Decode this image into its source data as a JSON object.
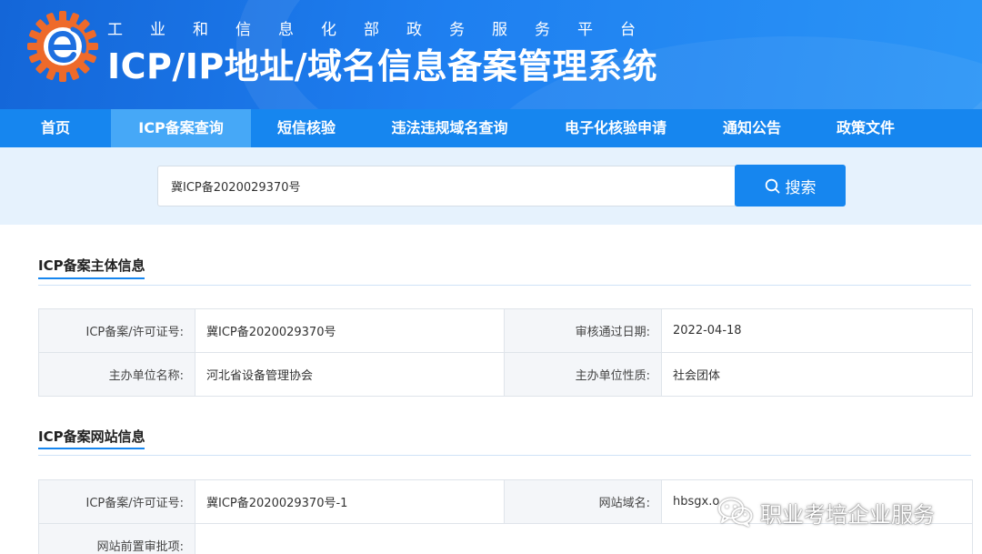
{
  "header": {
    "subtitle": "工业和信息化部政务服务平台",
    "title": "ICP/IP地址/域名信息备案管理系统"
  },
  "nav": {
    "items": [
      {
        "label": "首页",
        "active": false
      },
      {
        "label": "ICP备案查询",
        "active": true
      },
      {
        "label": "短信核验",
        "active": false
      },
      {
        "label": "违法违规域名查询",
        "active": false
      },
      {
        "label": "电子化核验申请",
        "active": false
      },
      {
        "label": "通知公告",
        "active": false
      },
      {
        "label": "政策文件",
        "active": false
      }
    ]
  },
  "search": {
    "value": "冀ICP备2020029370号",
    "button_label": "搜索",
    "button_icon": "search-icon"
  },
  "subject_info": {
    "title": "ICP备案主体信息",
    "rows": [
      {
        "label1": "ICP备案/许可证号:",
        "value1": "冀ICP备2020029370号",
        "label2": "审核通过日期:",
        "value2": "2022-04-18"
      },
      {
        "label1": "主办单位名称:",
        "value1": "河北省设备管理协会",
        "label2": "主办单位性质:",
        "value2": "社会团体"
      }
    ]
  },
  "website_info": {
    "title": "ICP备案网站信息",
    "rows": [
      {
        "label1": "ICP备案/许可证号:",
        "value1": "冀ICP备2020029370号-1",
        "label2": "网站域名:",
        "value2": "hbsgx.o"
      },
      {
        "label1": "网站前置审批项:",
        "value1": "",
        "label2": "",
        "value2": ""
      }
    ]
  },
  "watermark": {
    "text": "职业考培企业服务",
    "icon": "wechat-icon"
  },
  "colors": {
    "header_start": "#1466d8",
    "header_end": "#2b95f6",
    "nav": "#1686ef",
    "nav_active": "#46a8f7",
    "search_band": "#e6f2fd",
    "accent": "#1686ef",
    "logo_orange": "#ee6a2a"
  }
}
